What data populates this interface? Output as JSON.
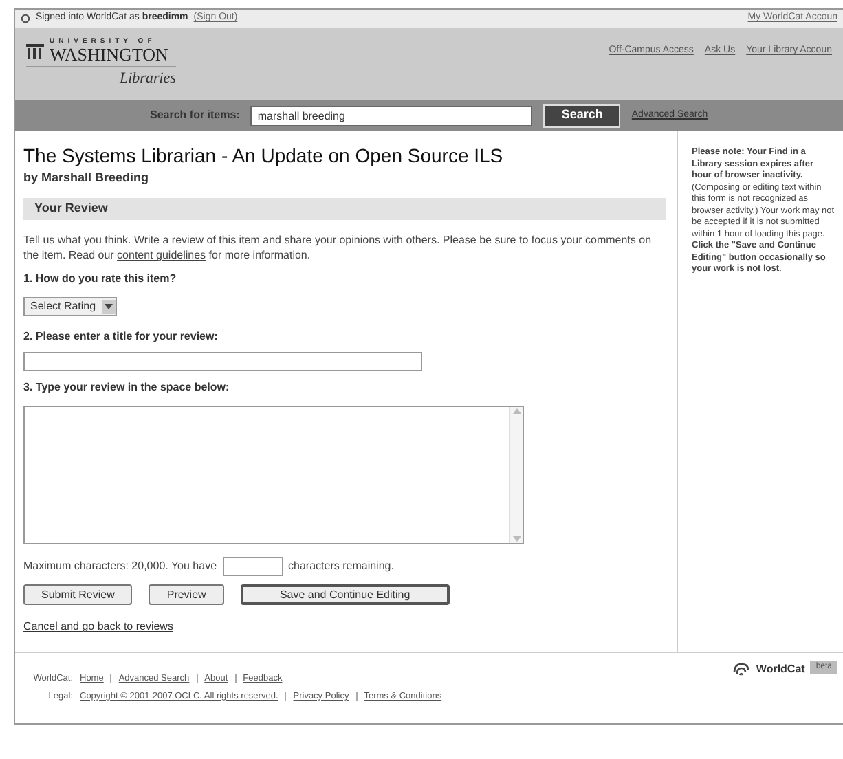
{
  "signin": {
    "prefix": "Signed into WorldCat as",
    "user": "breedimm",
    "signout": "(Sign Out)",
    "account_link": "My WorldCat Accoun"
  },
  "header": {
    "logo_small": "UNIVERSITY OF",
    "logo_big": "WASHINGTON",
    "logo_sub": "Libraries",
    "links": [
      "Off-Campus Access",
      "Ask Us",
      "Your Library Accoun"
    ]
  },
  "search": {
    "label": "Search for items:",
    "value": "marshall breeding",
    "button": "Search",
    "advanced": "Advanced Search"
  },
  "item": {
    "title": "The Systems Librarian - An Update on Open Source ILS",
    "author": "by Marshall Breeding"
  },
  "review": {
    "heading": "Your Review",
    "intro_before": "Tell us what you think. Write a review of this item and share your opinions with others. Please be sure to focus your comments on the item. Read our",
    "intro_link": "content guidelines",
    "intro_after": "for more information.",
    "q1": "1. How do you rate this item?",
    "rating": "Select Rating",
    "q2": "2. Please enter a title for your review:",
    "q3": "3. Type your review in the space below:",
    "max_before": "Maximum characters: 20,000. You have",
    "max_after": "characters remaining.",
    "buttons": [
      {
        "label": "Submit Review",
        "kind": "normal"
      },
      {
        "label": "Preview",
        "kind": "normal"
      },
      {
        "label": "Save and Continue Editing",
        "kind": "default"
      }
    ],
    "cancel": "Cancel and go back to reviews"
  },
  "note": "**Please note: Your Find in a Library session expires after hour of browser inactivity.** (Composing or editing text within this form is not recognized as browser activity.) Your work may not be accepted if it is not submitted within 1 hour of loading this page. **Click the \"Save and Continue Editing\" button occasionally so your work is not lost.**",
  "footer": {
    "rows": [
      {
        "label": "WorldCat:",
        "links": [
          "Home",
          "Advanced Search",
          "About",
          "Feedback"
        ]
      },
      {
        "label": "Legal:",
        "links": [
          "Copyright © 2001-2007 OCLC. All rights reserved.",
          "Privacy Policy",
          "Terms & Conditions"
        ]
      }
    ],
    "brand": "WorldCat",
    "badge": "beta"
  }
}
